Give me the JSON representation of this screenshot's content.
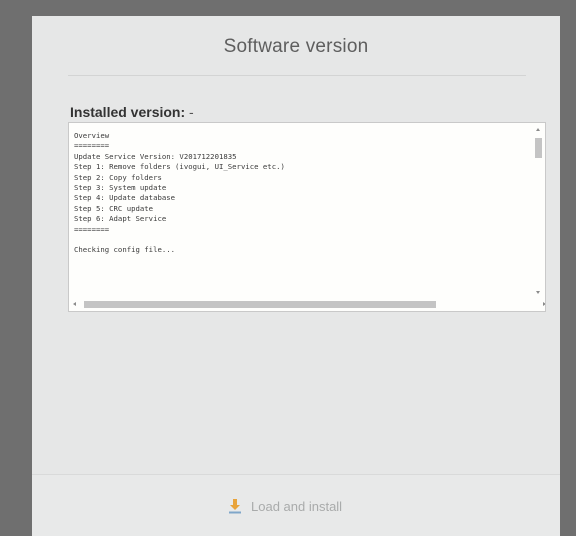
{
  "dialog": {
    "title": "Software version",
    "installed_label": "Installed version:",
    "installed_value": " -",
    "log_lines": [
      "Overview",
      "========",
      "Update Service Version: V201712201835",
      "Step 1: Remove folders (ivogui, UI_Service etc.)",
      "Step 2: Copy folders",
      "Step 3: System update",
      "Step 4: Update database",
      "Step 5: CRC update",
      "Step 6: Adapt Service",
      "========",
      "",
      "Checking config file..."
    ],
    "load_button_label": "Load and install",
    "download_icon": "download-icon",
    "accent_color": "#e8a33a"
  }
}
